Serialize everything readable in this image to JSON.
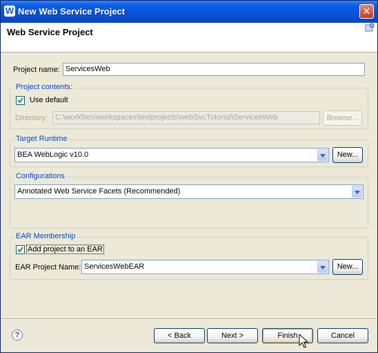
{
  "window": {
    "title": "New Web Service Project",
    "close_glyph": "✕",
    "app_icon_glyph": "W"
  },
  "banner": {
    "title": "Web Service Project"
  },
  "project_name": {
    "label": "Project name:",
    "value": "ServicesWeb"
  },
  "project_contents": {
    "title": "Project contents:",
    "use_default": {
      "label": "Use default",
      "checked": true
    },
    "directory": {
      "label": "Directory:",
      "value": "C:\\workfiles\\workspaces\\testprojects\\webSvcTutorial\\ServicesWeb"
    },
    "browse_label": "Browse..."
  },
  "target_runtime": {
    "title": "Target Runtime",
    "value": "BEA WebLogic v10.0",
    "new_label": "New..."
  },
  "configurations": {
    "title": "Configurations",
    "value": "Annotated Web Service Facets (Recommended)"
  },
  "ear_membership": {
    "title": "EAR Membership",
    "add_to_ear": {
      "label": "Add project to an EAR",
      "checked": true
    },
    "ear_name_label": "EAR Project Name:",
    "ear_name_value": "ServicesWebEAR",
    "new_label": "New..."
  },
  "footer": {
    "help_glyph": "?",
    "back_label": "< Back",
    "next_label": "Next >",
    "finish_label": "Finish",
    "cancel_label": "Cancel"
  }
}
